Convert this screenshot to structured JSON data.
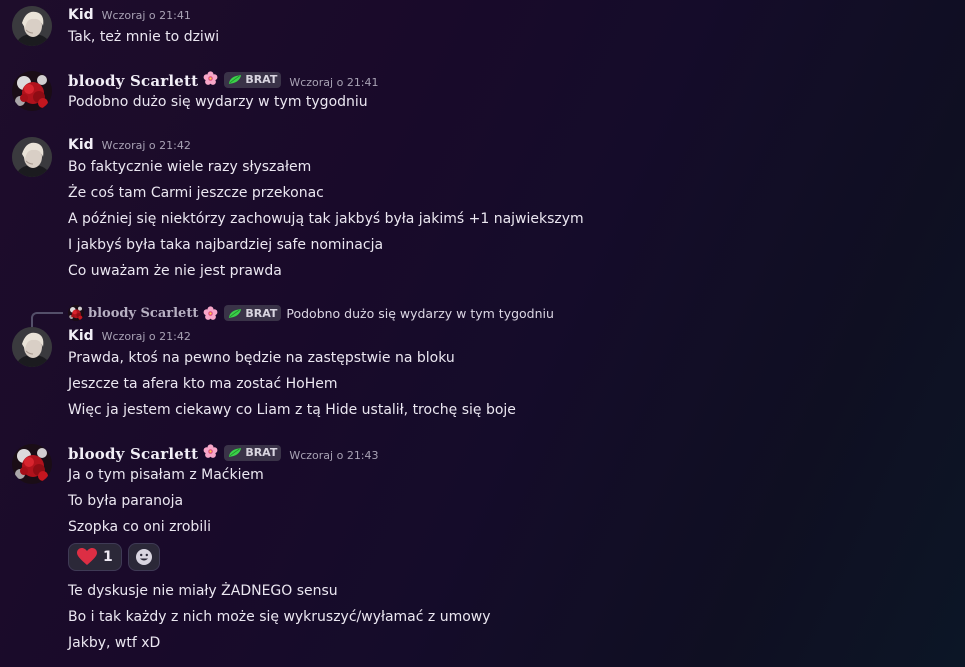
{
  "messages": [
    {
      "author": "Kid",
      "timestamp": "Wczoraj o 21:41",
      "lines": [
        "Tak, też mnie to dziwi"
      ]
    },
    {
      "author": "bloody Scarlett",
      "tag": "BRAT",
      "timestamp": "Wczoraj o 21:41",
      "lines": [
        "Podobno dużo się wydarzy w tym tygodniu"
      ]
    },
    {
      "author": "Kid",
      "timestamp": "Wczoraj o 21:42",
      "lines": [
        "Bo faktycznie wiele razy słyszałem",
        "Że coś tam Carmi jeszcze przekonac",
        "A później się niektórzy zachowują tak jakbyś była jakimś +1 najwiekszym",
        "I jakbyś była taka najbardziej safe nominacja",
        "Co uważam że nie jest prawda"
      ]
    },
    {
      "reply_to": {
        "author": "bloody Scarlett",
        "tag": "BRAT",
        "text": "Podobno dużo się wydarzy w tym tygodniu"
      },
      "author": "Kid",
      "timestamp": "Wczoraj o 21:42",
      "lines": [
        "Prawda, ktoś na pewno będzie na zastępstwie na bloku",
        "Jeszcze ta afera kto ma zostać HoHem",
        "Więc ja jestem ciekawy co Liam z tą Hide ustalił, trochę się boje"
      ]
    },
    {
      "author": "bloody Scarlett",
      "tag": "BRAT",
      "timestamp": "Wczoraj o 21:43",
      "lines": [
        "Ja o tym pisałam z Maćkiem",
        "To była paranoja",
        "Szopka co oni zrobili"
      ],
      "reaction": {
        "emoji": "heart-icon",
        "count": "1"
      },
      "more_lines": [
        "Te dyskusje nie miały ŻADNEGO sensu",
        "Bo i tak każdy z nich może się wykruszyć/wyłamać z umowy",
        "Jakby, wtf xD"
      ]
    }
  ],
  "icons": {
    "flower": "cherry-blossom-icon",
    "leaf": "leaf-icon",
    "add_reaction": "smiley-add-reaction-icon"
  },
  "colors": {
    "tag_bg": "#3a3348",
    "leaf_green": "#3bd14a",
    "heart_red": "#dd2e44",
    "flower_pink": "#f7a6c8"
  }
}
